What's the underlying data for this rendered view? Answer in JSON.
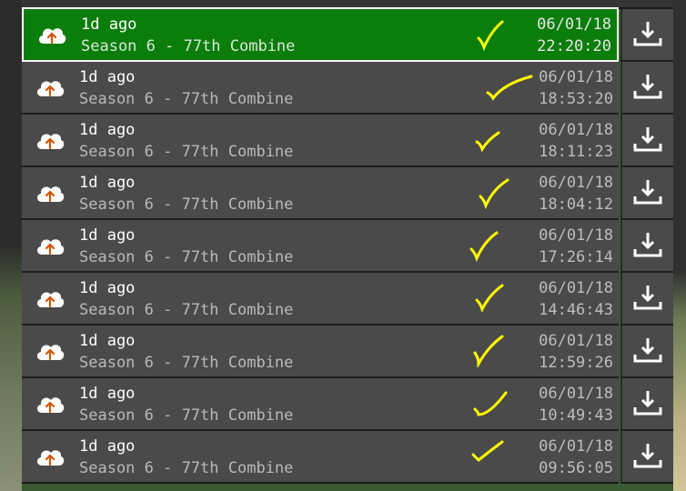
{
  "rows": [
    {
      "title": "1d ago",
      "subtitle": "Season 6 - 77th Combine",
      "date": "06/01/18",
      "time": "22:20:20",
      "selected": true
    },
    {
      "title": "1d ago",
      "subtitle": "Season 6 - 77th Combine",
      "date": "06/01/18",
      "time": "18:53:20",
      "selected": false
    },
    {
      "title": "1d ago",
      "subtitle": "Season 6 - 77th Combine",
      "date": "06/01/18",
      "time": "18:11:23",
      "selected": false
    },
    {
      "title": "1d ago",
      "subtitle": "Season 6 - 77th Combine",
      "date": "06/01/18",
      "time": "18:04:12",
      "selected": false
    },
    {
      "title": "1d ago",
      "subtitle": "Season 6 - 77th Combine",
      "date": "06/01/18",
      "time": "17:26:14",
      "selected": false
    },
    {
      "title": "1d ago",
      "subtitle": "Season 6 - 77th Combine",
      "date": "06/01/18",
      "time": "14:46:43",
      "selected": false
    },
    {
      "title": "1d ago",
      "subtitle": "Season 6 - 77th Combine",
      "date": "06/01/18",
      "time": "12:59:26",
      "selected": false
    },
    {
      "title": "1d ago",
      "subtitle": "Season 6 - 77th Combine",
      "date": "06/01/18",
      "time": "10:49:43",
      "selected": false
    },
    {
      "title": "1d ago",
      "subtitle": "Season 6 - 77th Combine",
      "date": "06/01/18",
      "time": "09:56:05",
      "selected": false
    }
  ],
  "icons": {
    "row_icon": "cloud-upload-icon",
    "action_icon": "download-icon",
    "mark_icon": "handwritten-checkmark-icon"
  },
  "colors": {
    "row_bg": "#4a4a4a",
    "selected_bg": "#0b7d0b",
    "selected_border": "#ffffff",
    "checkmark": "#ffff00",
    "title_text": "#ffffff",
    "secondary_text": "#b9b9b9"
  }
}
